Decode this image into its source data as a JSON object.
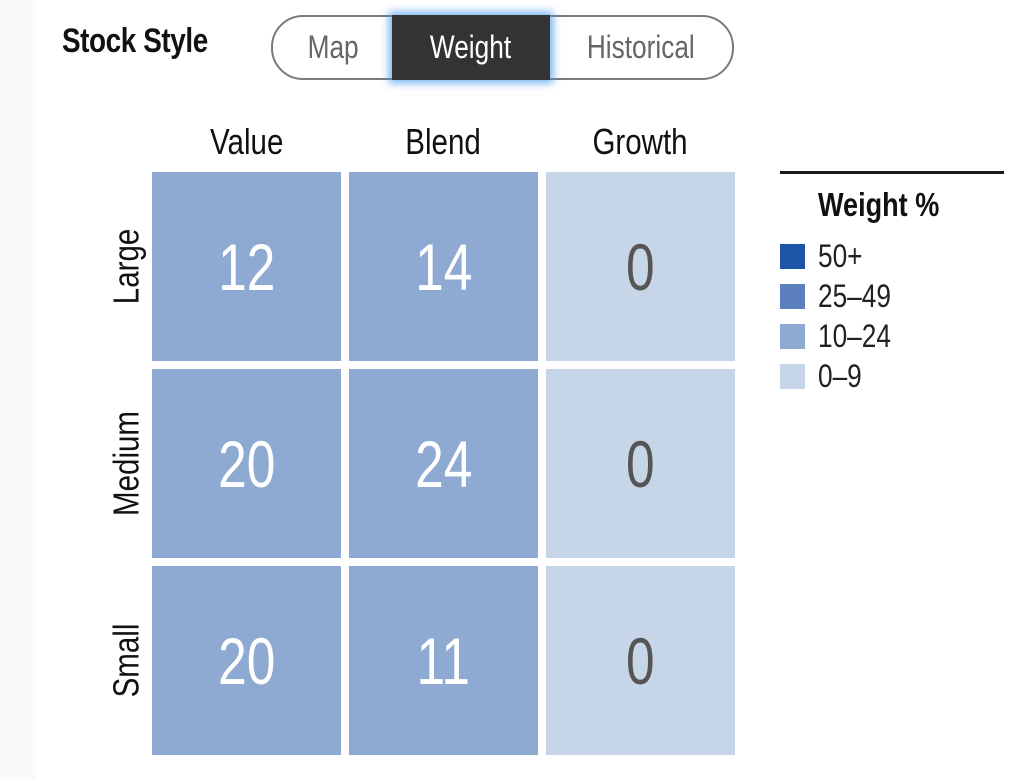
{
  "header": {
    "title": "Stock Style",
    "toggle": {
      "options": [
        "Map",
        "Weight",
        "Historical"
      ],
      "selected": "Weight"
    }
  },
  "chart_data": {
    "type": "heatmap",
    "title": "Stock Style",
    "columns": [
      "Value",
      "Blend",
      "Growth"
    ],
    "rows": [
      "Large",
      "Medium",
      "Small"
    ],
    "values": [
      [
        12,
        14,
        0
      ],
      [
        20,
        24,
        0
      ],
      [
        20,
        11,
        0
      ]
    ],
    "legend": {
      "title": "Weight %",
      "placement": "right",
      "bins": [
        {
          "label": "50+",
          "min": 50,
          "max": 100,
          "color": "#1f55a6"
        },
        {
          "label": "25–49",
          "min": 25,
          "max": 49,
          "color": "#5b80bd"
        },
        {
          "label": "10–24",
          "min": 10,
          "max": 24,
          "color": "#8eaad2"
        },
        {
          "label": "0–9",
          "min": 0,
          "max": 9,
          "color": "#c6d5e8"
        }
      ]
    },
    "text_colors": {
      "dark_cell": "#ffffff",
      "light_cell": "#555555"
    }
  }
}
